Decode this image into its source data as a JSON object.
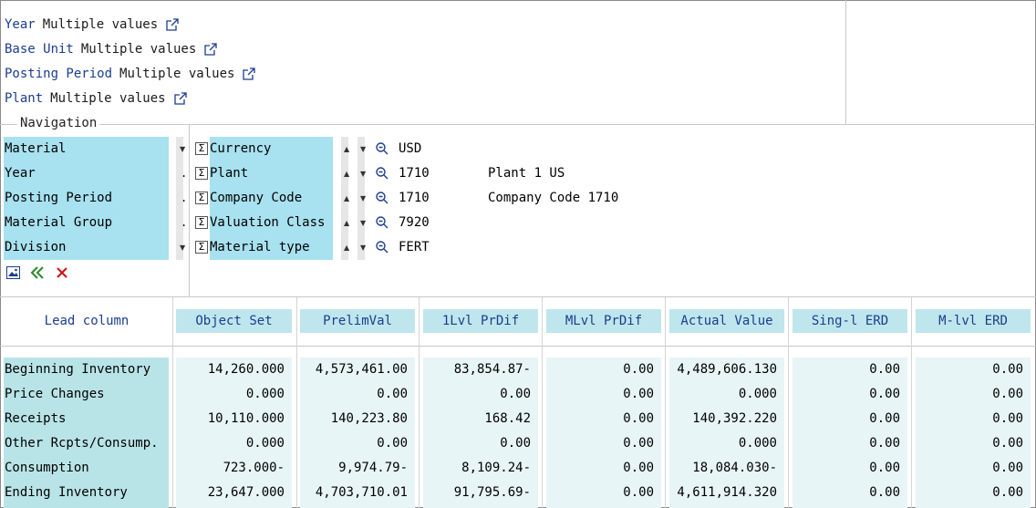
{
  "filters": [
    {
      "label": "Year",
      "value": "Multiple values"
    },
    {
      "label": "Base Unit",
      "value": "Multiple values"
    },
    {
      "label": "Posting Period",
      "value": "Multiple values"
    },
    {
      "label": "Plant",
      "value": "Multiple values"
    }
  ],
  "navigation": {
    "legend": "Navigation",
    "rows": [
      "Material",
      "Year",
      "Posting Period",
      "Material Group",
      "Division"
    ],
    "row_markers": [
      "",
      ".",
      ".",
      ".",
      ""
    ],
    "columns": [
      {
        "label": "Currency",
        "value": "USD",
        "desc": ""
      },
      {
        "label": "Plant",
        "value": "1710",
        "desc": "Plant 1 US"
      },
      {
        "label": "Company Code",
        "value": "1710",
        "desc": "Company Code 1710"
      },
      {
        "label": "Valuation Class",
        "value": "7920",
        "desc": ""
      },
      {
        "label": "Material type",
        "value": "FERT",
        "desc": ""
      }
    ],
    "sigma": "Σ"
  },
  "table": {
    "lead_column": "Lead column",
    "headers": [
      "Object Set",
      "PrelimVal",
      "1Lvl PrDif",
      "MLvl PrDif",
      "Actual Value",
      "Sing-l ERD",
      "M-lvl ERD"
    ],
    "rows": [
      {
        "label": "Beginning Inventory",
        "values": [
          "14,260.000",
          "4,573,461.00",
          "83,854.87-",
          "0.00",
          "4,489,606.130",
          "0.00",
          "0.00"
        ]
      },
      {
        "label": "Price Changes",
        "values": [
          "0.000",
          "0.00",
          "0.00",
          "0.00",
          "0.000",
          "0.00",
          "0.00"
        ]
      },
      {
        "label": "Receipts",
        "values": [
          "10,110.000",
          "140,223.80",
          "168.42",
          "0.00",
          "140,392.220",
          "0.00",
          "0.00"
        ]
      },
      {
        "label": "Other Rcpts/Consump.",
        "values": [
          "0.000",
          "0.00",
          "0.00",
          "0.00",
          "0.000",
          "0.00",
          "0.00"
        ]
      },
      {
        "label": "Consumption",
        "values": [
          "723.000-",
          "9,974.79-",
          "8,109.24-",
          "0.00",
          "18,084.030-",
          "0.00",
          "0.00"
        ]
      },
      {
        "label": "Ending Inventory",
        "values": [
          "23,647.000",
          "4,703,710.01",
          "91,795.69-",
          "0.00",
          "4,611,914.320",
          "0.00",
          "0.00"
        ]
      }
    ]
  },
  "colors": {
    "nav_highlight": "#a8e1ef",
    "header_cell": "#bfe6ec",
    "row_label": "#b9e4e7",
    "value_cell": "#e8f5f7",
    "link_text": "#1a3d8f",
    "delete_red": "#cc1111",
    "expand_green": "#2a8a2a"
  },
  "icons": {
    "filter_value": "external-link-icon",
    "nav_sum": "sigma-icon",
    "nav_sort": "triangle-sort-icon",
    "nav_filter": "magnifier-icon",
    "tool_graphic": "picture-icon",
    "tool_expand": "double-chevron-left-icon",
    "tool_delete": "close-icon"
  }
}
